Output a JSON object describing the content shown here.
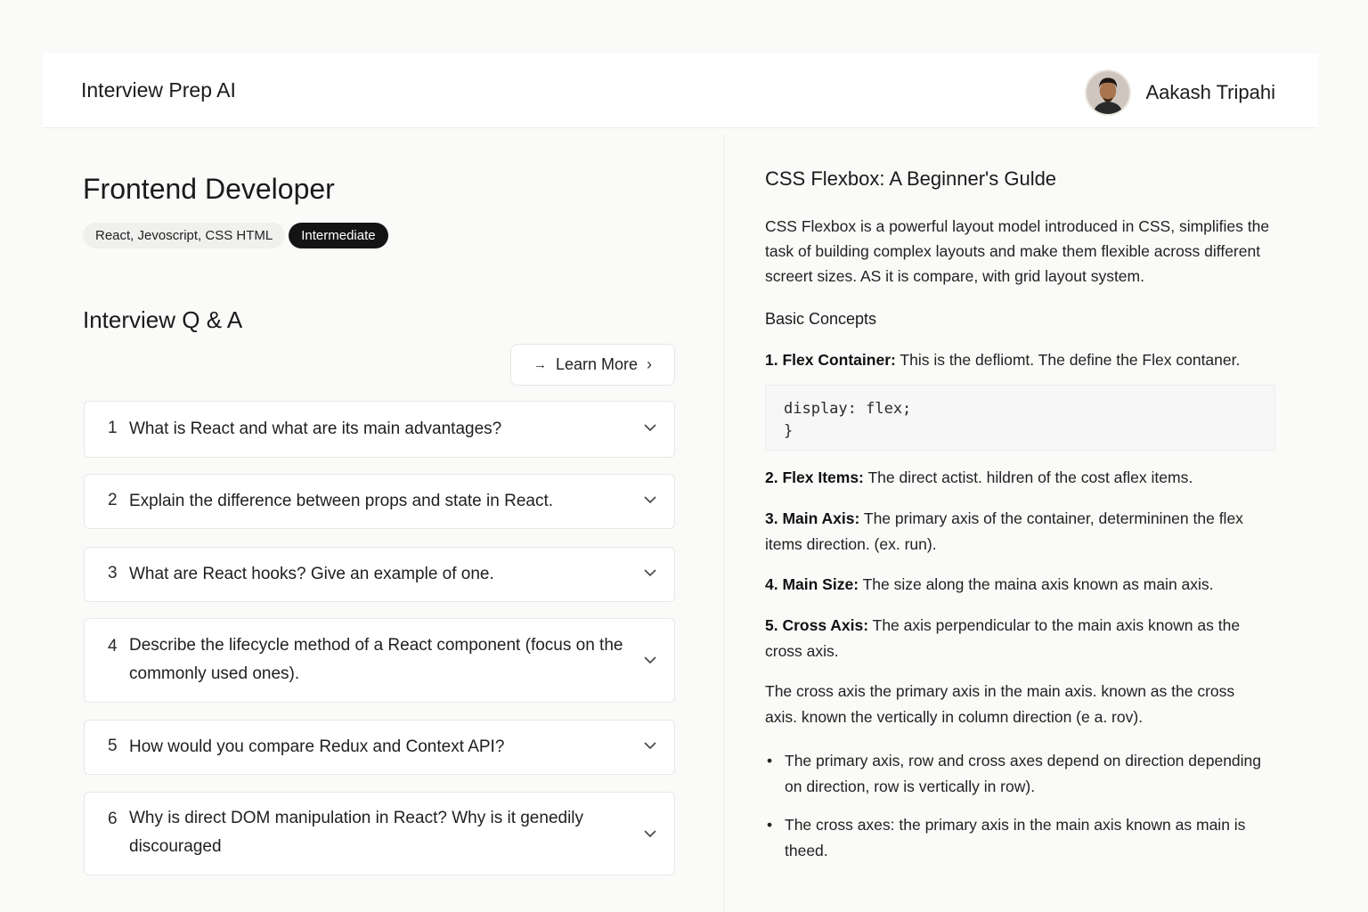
{
  "header": {
    "app_title": "Interview Prep AI",
    "user_name": "Aakash Tripahi",
    "avatar_icon": "user-avatar"
  },
  "role": {
    "title": "Frontend Developer",
    "skills_tag": "React, Jevoscript, CSS HTML",
    "level_tag": "Intermediate"
  },
  "qa": {
    "title": "Interview Q & A",
    "learn_more": "Learn More",
    "questions": [
      {
        "num": "1",
        "text": "What is React and what are its main advantages?"
      },
      {
        "num": "2",
        "text": "Explain the difference between props and state in React."
      },
      {
        "num": "3",
        "text": "What are React hooks? Give an example of one."
      },
      {
        "num": "4",
        "text": "Describe the lifecycle method of a React component (focus on the commonly used ones)."
      },
      {
        "num": "5",
        "text": "How would you compare Redux and Context API?"
      },
      {
        "num": "6",
        "text": "Why is direct DOM manipulation in React? Why is it genedily discouraged"
      }
    ]
  },
  "article": {
    "title": "CSS Flexbox: A Beginner's Gulde",
    "intro": "CSS Flexbox is a powerful layout model introduced in CSS, simplifies the task of building complex layouts and make them flexible across different screert sizes. AS it is compare, with grid layout system.",
    "section_heading": "Basic Concepts",
    "item1_label": "1. Flex Container:",
    "item1_text": "This is the defliomt. The define the Flex contaner.",
    "code_line1": "display: flex;",
    "code_line2": "}",
    "item2_label": "2. Flex Items:",
    "item2_text": "The direct actist. hildren of the cost aflex items.",
    "item3_label": "3. Main Axis:",
    "item3_text": "The primary axis of the container, determininen the flex items direction. (ex. run).",
    "item4_label": "4. Main Size:",
    "item4_text": "The size along the maina axis known as main axis.",
    "item5_label": "5. Cross Axis:",
    "item5_text": "The axis perpendicular to the main axis known as the cross axis.",
    "para2": "The cross axis the primary axis in the main axis. known as the cross axis. known the vertically in column direction (e a. rov).",
    "bullets": [
      "The primary axis, row and cross axes depend on direction depending on direction, row is vertically in row).",
      "The cross axes: the primary axis in the main axis known as main is theed."
    ]
  }
}
